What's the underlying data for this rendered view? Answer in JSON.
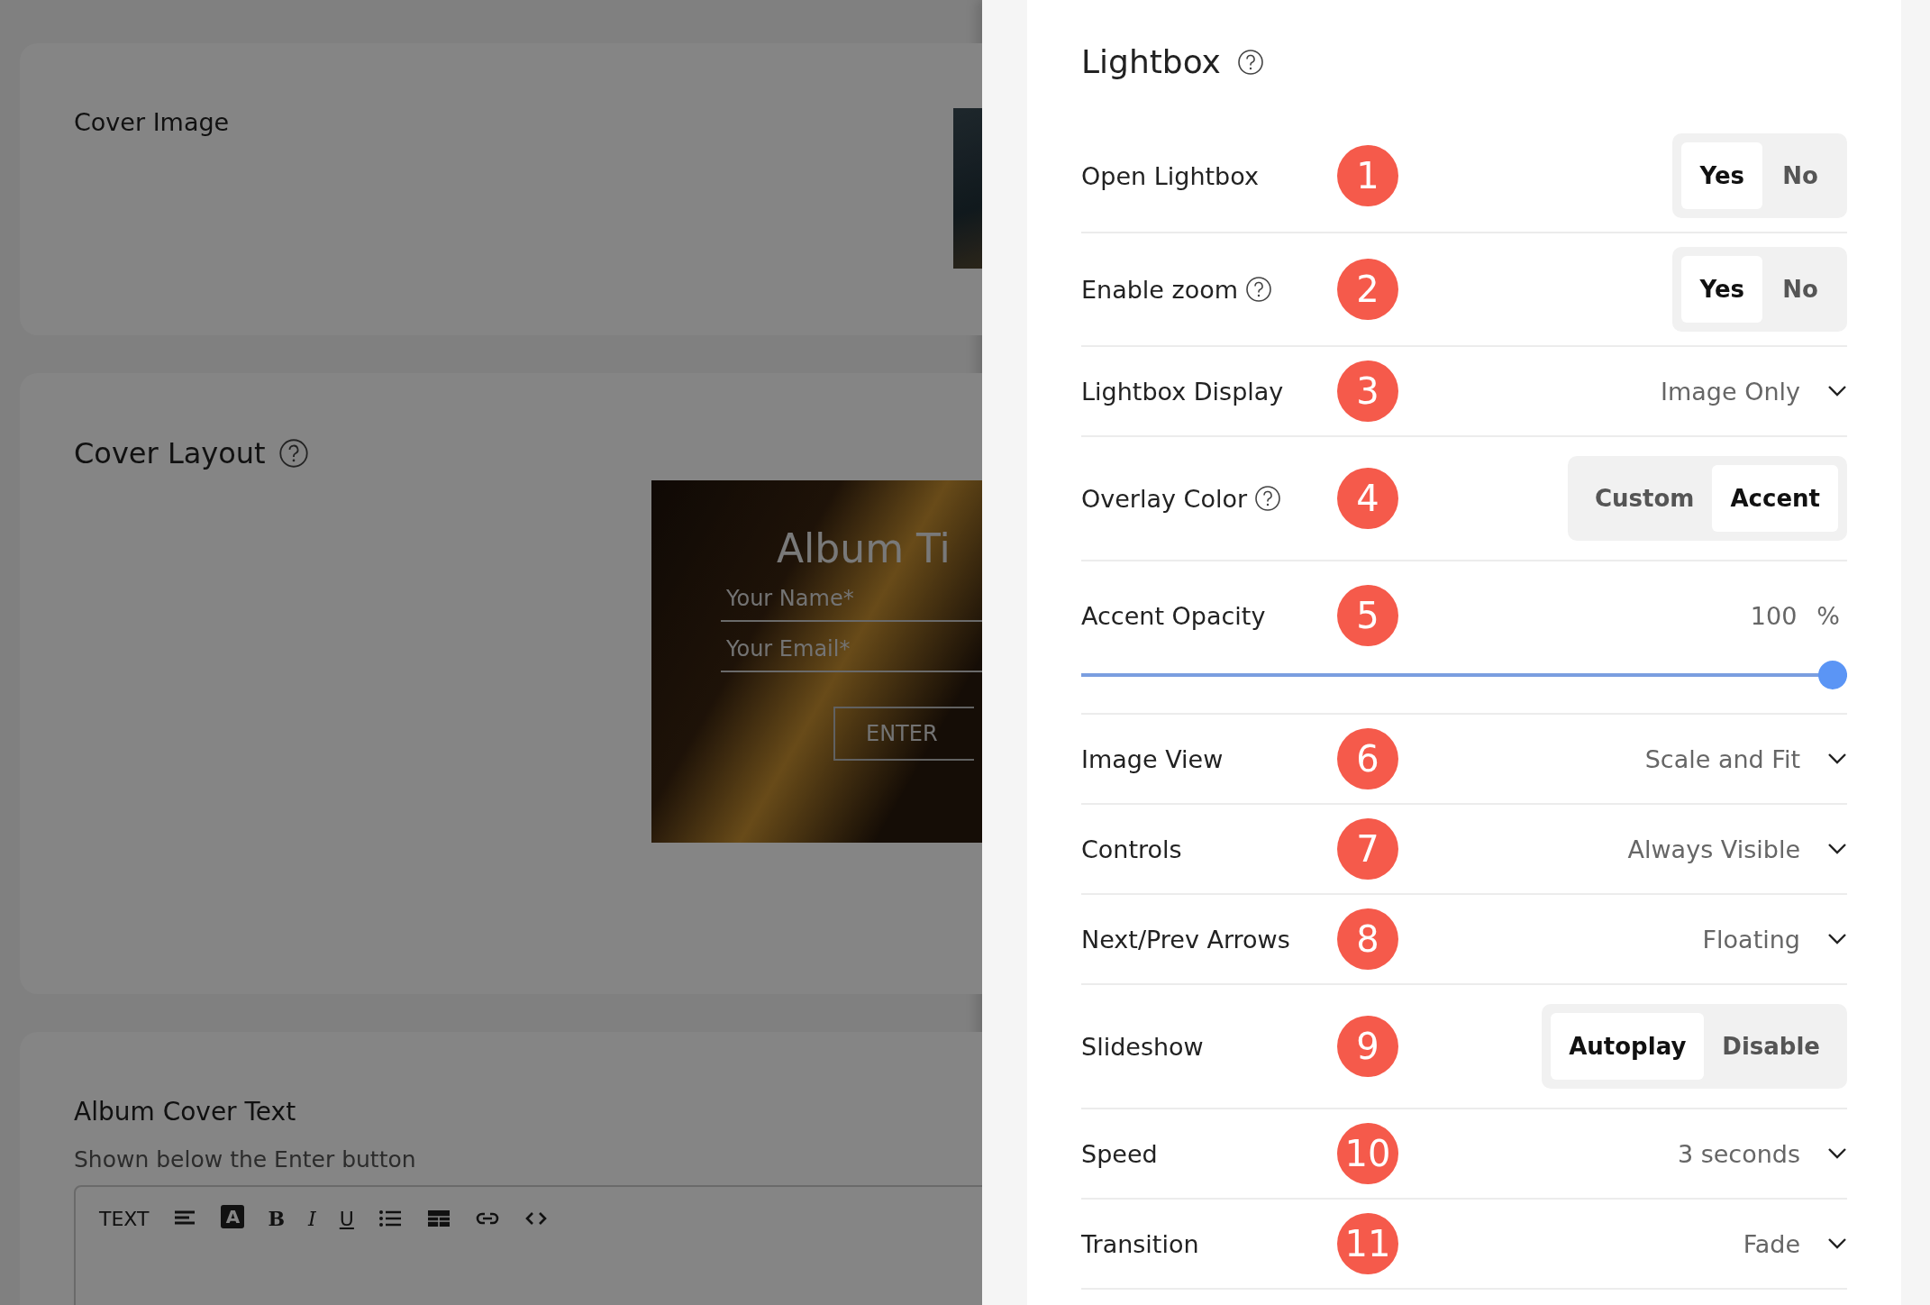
{
  "background": {
    "cover_image": {
      "title": "Cover Image"
    },
    "cover_layout": {
      "title": "Cover Layout",
      "preview": {
        "title": "Album Ti",
        "fields": [
          "Your Name*",
          "Your Email*"
        ],
        "button": "ENTER"
      }
    },
    "cover_text": {
      "title": "Album Cover Text",
      "subtitle": "Shown below the Enter button",
      "toolbar": [
        {
          "kind": "label",
          "text": "TEXT"
        },
        {
          "kind": "align"
        },
        {
          "kind": "color",
          "text": "A"
        },
        {
          "kind": "bold",
          "text": "B"
        },
        {
          "kind": "italic",
          "text": "I"
        },
        {
          "kind": "underline",
          "text": "U"
        },
        {
          "kind": "list"
        },
        {
          "kind": "table"
        },
        {
          "kind": "link"
        },
        {
          "kind": "code"
        }
      ]
    }
  },
  "panel": {
    "title": "Lightbox",
    "rows": [
      {
        "kind": "segmented",
        "label": "Open Lightbox",
        "help": false,
        "badge": "1",
        "options": [
          {
            "label": "Yes",
            "selected": true
          },
          {
            "label": "No",
            "selected": false
          }
        ]
      },
      {
        "kind": "segmented",
        "label": "Enable zoom",
        "help": true,
        "badge": "2",
        "options": [
          {
            "label": "Yes",
            "selected": true
          },
          {
            "label": "No",
            "selected": false
          }
        ]
      },
      {
        "kind": "select",
        "label": "Lightbox Display",
        "help": false,
        "badge": "3",
        "value": "Image Only"
      },
      {
        "kind": "segmented",
        "label": "Overlay Color",
        "help": true,
        "badge": "4",
        "options": [
          {
            "label": "Custom",
            "selected": false
          },
          {
            "label": "Accent",
            "selected": true
          }
        ]
      },
      {
        "kind": "slider",
        "label": "Accent Opacity",
        "help": false,
        "badge": "5",
        "value": "100",
        "unit": "%",
        "level": 1
      },
      {
        "kind": "select",
        "label": "Image View",
        "help": false,
        "badge": "6",
        "value": "Scale and Fit"
      },
      {
        "kind": "select",
        "label": "Controls",
        "help": false,
        "badge": "7",
        "value": "Always Visible"
      },
      {
        "kind": "select",
        "label": "Next/Prev Arrows",
        "help": false,
        "badge": "8",
        "value": "Floating"
      },
      {
        "kind": "segmented",
        "label": "Slideshow",
        "help": false,
        "badge": "9",
        "options": [
          {
            "label": "Autoplay",
            "selected": true
          },
          {
            "label": "Disable",
            "selected": false
          }
        ]
      },
      {
        "kind": "select",
        "label": "Speed",
        "help": false,
        "badge": "10",
        "value": "3 seconds"
      },
      {
        "kind": "select",
        "label": "Transition",
        "help": false,
        "badge": "11",
        "value": "Fade"
      }
    ]
  }
}
